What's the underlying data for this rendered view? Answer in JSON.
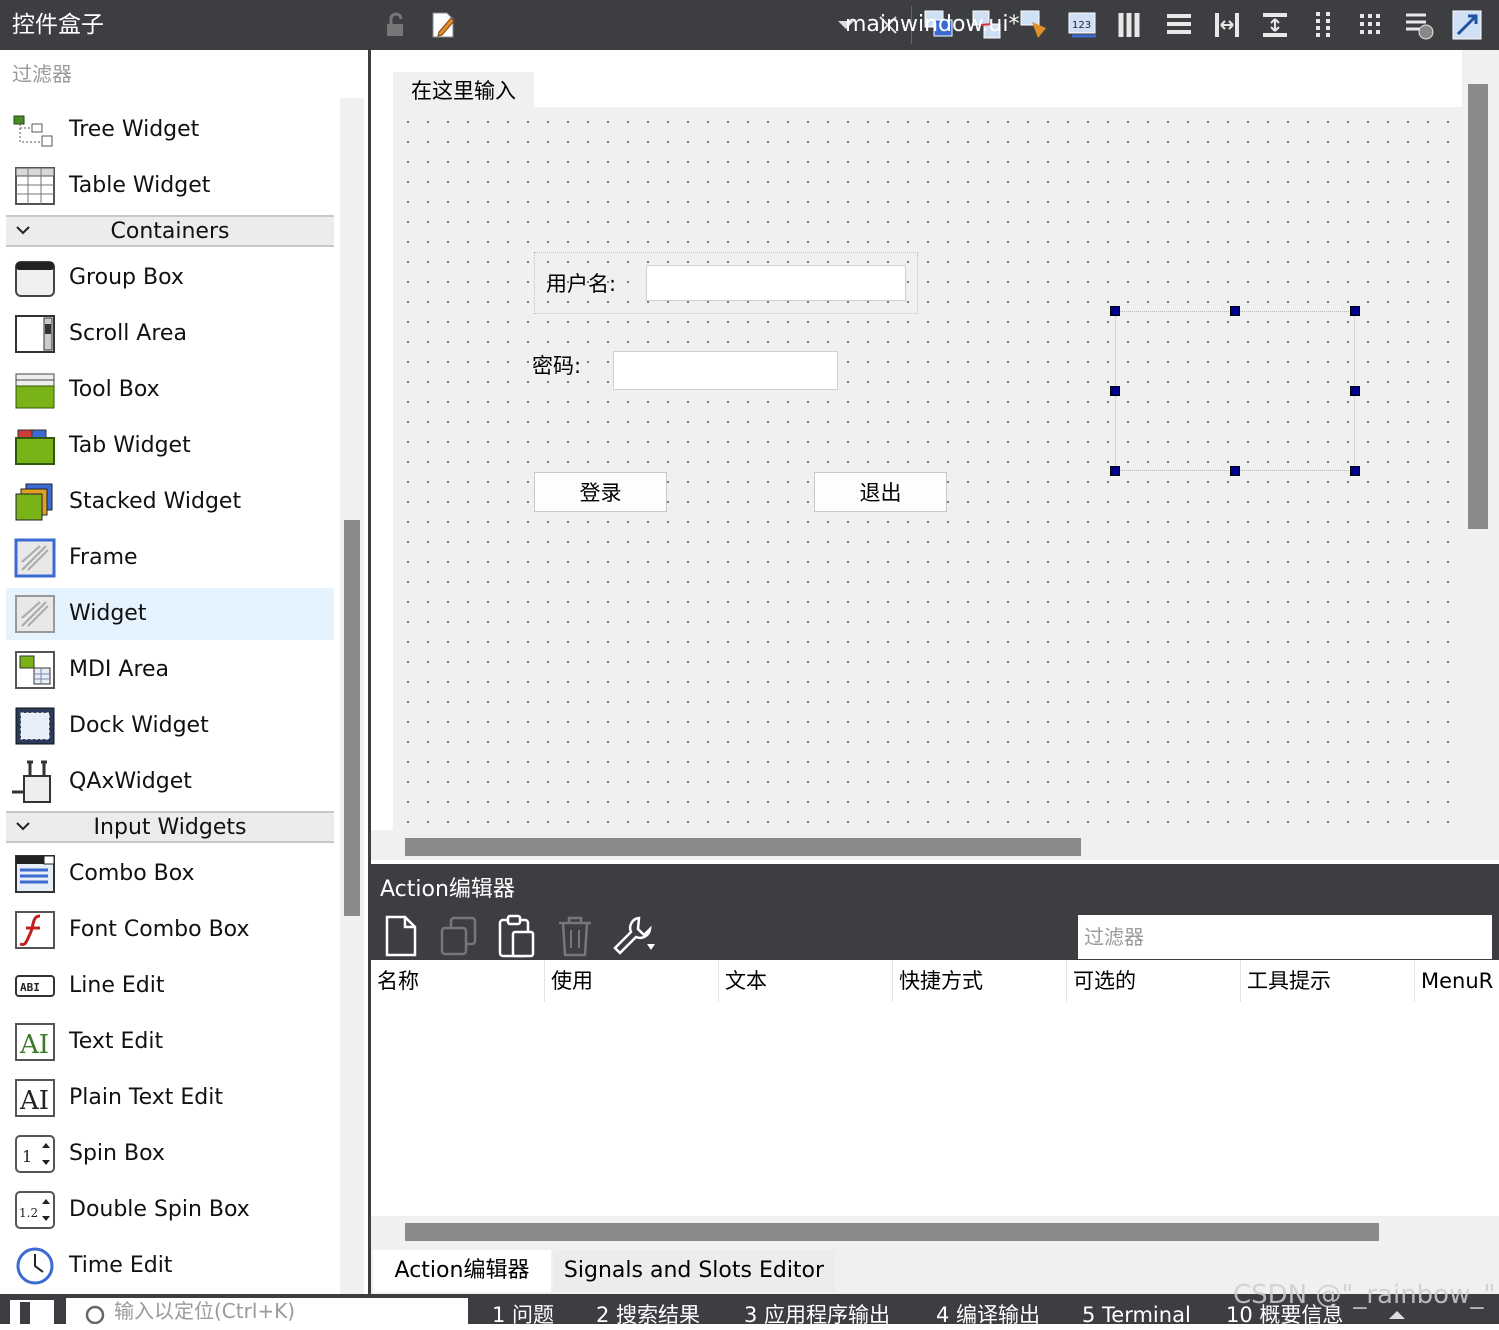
{
  "widget_box": {
    "title": "控件盒子",
    "filter_placeholder": "过滤器",
    "items": [
      {
        "label": "Tree Widget",
        "icon": "tree-widget-icon"
      },
      {
        "label": "Table Widget",
        "icon": "table-widget-icon"
      },
      {
        "category": "Containers"
      },
      {
        "label": "Group Box",
        "icon": "group-box-icon"
      },
      {
        "label": "Scroll Area",
        "icon": "scroll-area-icon"
      },
      {
        "label": "Tool Box",
        "icon": "tool-box-icon"
      },
      {
        "label": "Tab Widget",
        "icon": "tab-widget-icon"
      },
      {
        "label": "Stacked Widget",
        "icon": "stacked-widget-icon"
      },
      {
        "label": "Frame",
        "icon": "frame-icon"
      },
      {
        "label": "Widget",
        "icon": "widget-icon",
        "selected": true
      },
      {
        "label": "MDI Area",
        "icon": "mdi-area-icon"
      },
      {
        "label": "Dock Widget",
        "icon": "dock-widget-icon"
      },
      {
        "label": "QAxWidget",
        "icon": "qaxwidget-icon"
      },
      {
        "category": "Input Widgets"
      },
      {
        "label": "Combo Box",
        "icon": "combo-box-icon"
      },
      {
        "label": "Font Combo Box",
        "icon": "font-combo-box-icon"
      },
      {
        "label": "Line Edit",
        "icon": "line-edit-icon"
      },
      {
        "label": "Text Edit",
        "icon": "text-edit-icon"
      },
      {
        "label": "Plain Text Edit",
        "icon": "plain-text-edit-icon"
      },
      {
        "label": "Spin Box",
        "icon": "spin-box-icon"
      },
      {
        "label": "Double Spin Box",
        "icon": "double-spin-box-icon"
      },
      {
        "label": "Time Edit",
        "icon": "time-edit-icon"
      }
    ]
  },
  "editor": {
    "file_name": "mainwindow.ui*"
  },
  "form": {
    "menu_placeholder": "在这里输入",
    "username_label": "用户名:",
    "password_label": "密码:",
    "login_button": "登录",
    "exit_button": "退出"
  },
  "action_editor": {
    "title": "Action编辑器",
    "filter_placeholder": "过滤器",
    "columns": [
      "名称",
      "使用",
      "文本",
      "快捷方式",
      "可选的",
      "工具提示",
      "MenuR"
    ],
    "tabs": [
      "Action编辑器",
      "Signals and Slots Editor"
    ]
  },
  "status_bar": {
    "locator_placeholder": "输入以定位(Ctrl+K)",
    "tabs": [
      "1 问题",
      "2 搜索结果",
      "3 应用程序输出",
      "4 编译输出",
      "5 Terminal",
      "10 概要信息"
    ]
  },
  "watermark": "CSDN @\"_rainbow_\""
}
